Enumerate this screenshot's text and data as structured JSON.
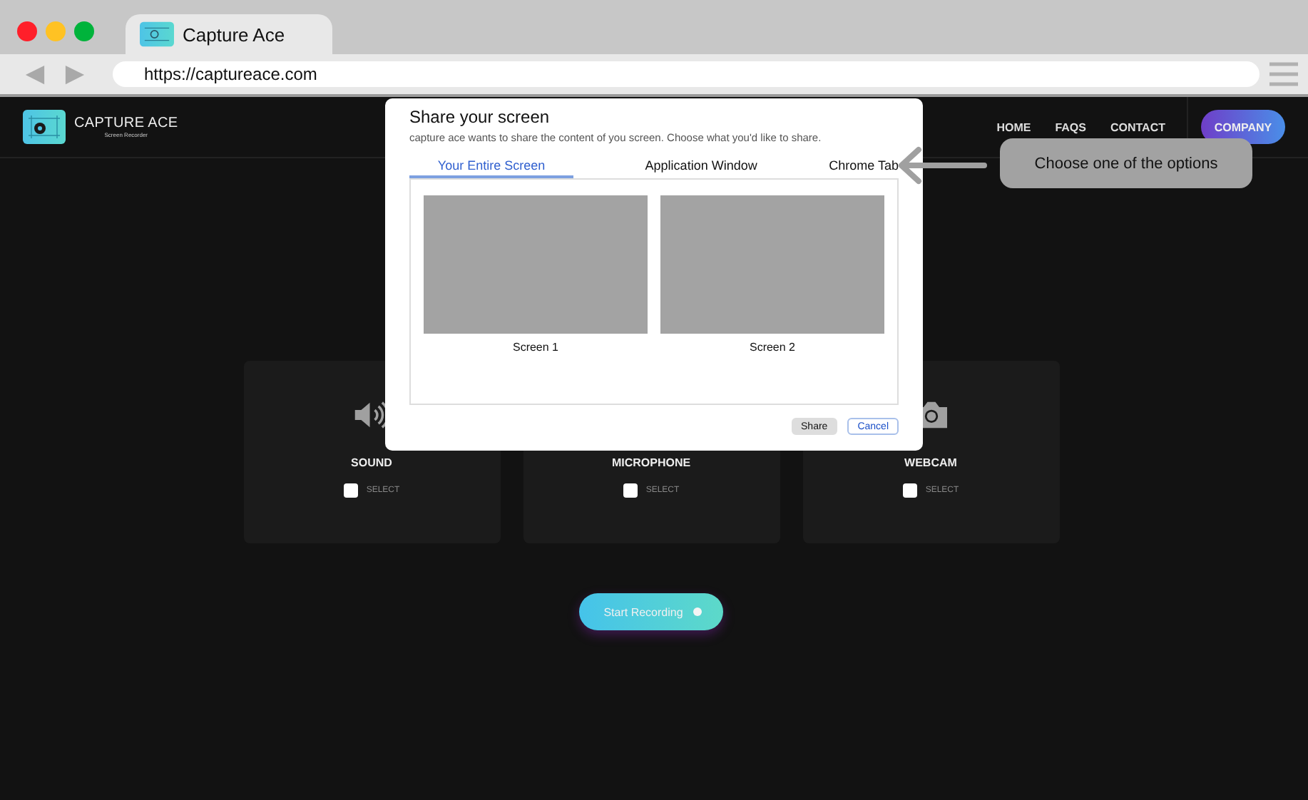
{
  "browser": {
    "tab_title": "Capture Ace",
    "url": "https://captureace.com"
  },
  "site": {
    "logo_title": "CAPTURE ACE",
    "logo_subtitle": "Screen Recorder",
    "nav": [
      "HOME",
      "FAQS",
      "CONTACT"
    ],
    "company_button": "COMPANY"
  },
  "sources": [
    {
      "kind": "sound",
      "label": "SOUND",
      "option": "SELECT",
      "checked": false
    },
    {
      "kind": "microphone",
      "label": "MICROPHONE",
      "option": "SELECT",
      "checked": false
    },
    {
      "kind": "webcam",
      "label": "WEBCAM",
      "option": "SELECT",
      "checked": false
    }
  ],
  "start_button": "Start Recording",
  "dialog": {
    "title": "Share your screen",
    "message": "capture ace wants to share the content of you screen. Choose what you'd like to share.",
    "tabs": [
      {
        "label": "Your Entire Screen",
        "selected": true
      },
      {
        "label": "Application Window",
        "selected": false
      },
      {
        "label": "Chrome Tab",
        "selected": false
      }
    ],
    "screens": [
      {
        "label": "Screen 1"
      },
      {
        "label": "Screen 2"
      }
    ],
    "share_button": "Share",
    "cancel_button": "Cancel"
  },
  "callout": "Choose one of the options"
}
